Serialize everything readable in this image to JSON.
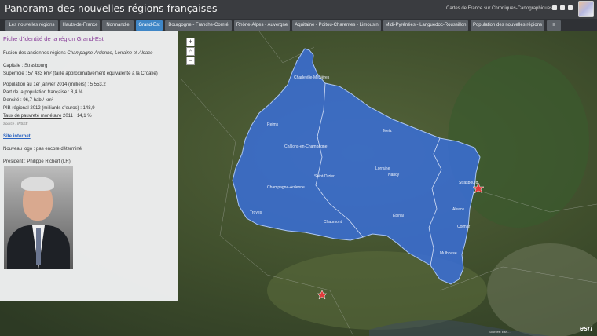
{
  "header": {
    "title": "Panorama des nouvelles régions françaises",
    "link_text": "Cartes de France sur Chroniques-Cartographiques",
    "social_icons": [
      "facebook-icon",
      "twitter-icon",
      "link-icon"
    ]
  },
  "tabs": [
    {
      "label": "Les nouvelles régions",
      "active": false
    },
    {
      "label": "Hauts-de-France",
      "active": false
    },
    {
      "label": "Normandie",
      "active": false
    },
    {
      "label": "Grand-Est",
      "active": true
    },
    {
      "label": "Bourgogne - Franche-Comté",
      "active": false
    },
    {
      "label": "Rhône-Alpes - Auvergne",
      "active": false
    },
    {
      "label": "Aquitaine - Poitou-Charentes - Limousin",
      "active": false
    },
    {
      "label": "Midi-Pyrénées - Languedoc-Roussillon",
      "active": false
    },
    {
      "label": "Population des nouvelles régions",
      "active": false
    },
    {
      "label": "≡",
      "active": false
    }
  ],
  "panel": {
    "title": "Fiche d'identité de la région Grand-Est",
    "fusion_prefix": "Fusion des anciennes régions ",
    "fusion_r1": "Champagne-Ardenne",
    "fusion_sep": ", ",
    "fusion_r2": "Lorraine",
    "fusion_and": " et ",
    "fusion_r3": "Alsace",
    "capital_label": "Capitale : ",
    "capital_value": "Strasbourg",
    "surface": "Superficie : 57 433 km² (taille approximativement équivalente à la Croatie)",
    "population": "Population au 1er janvier 2014 (milliers) : 5 553,2",
    "share": "Part de la population française : 8,4 %",
    "density": "Densité : 96,7 hab / km²",
    "pib": "PIB régional 2012 (milliards d'euros) : 148,9",
    "poverty_label": "Taux de pauvreté monétaire",
    "poverty_value": " 2011 : 14,1 %",
    "source": "Source : INSEE",
    "site_link": "Site internet",
    "logo": "Nouveau logo : pas encore déterminé",
    "president": "Président : Philippe Richert (LR)"
  },
  "map": {
    "zoom_in": "+",
    "home": "⌂",
    "zoom_out": "−",
    "region_color": "#3a6fd8",
    "labels": [
      "Charleville-Mézières",
      "Reims",
      "Châlons-en-Champagne",
      "Champagne-Ardenne",
      "Metz",
      "Lorraine",
      "Nancy",
      "Saint-Dizier",
      "Épinal",
      "Chaumont",
      "Strasbourg",
      "Alsace",
      "Colmar",
      "Mulhouse",
      "Troyes"
    ],
    "attribution": "Sources: Esri, DigitalGlobe, GeoEye, i-cubed, USDA, USGS, AEX, Getmapping, Aerogrid, IGN, IGP, swisstopo, and the GIS User Community",
    "esri": "esri"
  }
}
